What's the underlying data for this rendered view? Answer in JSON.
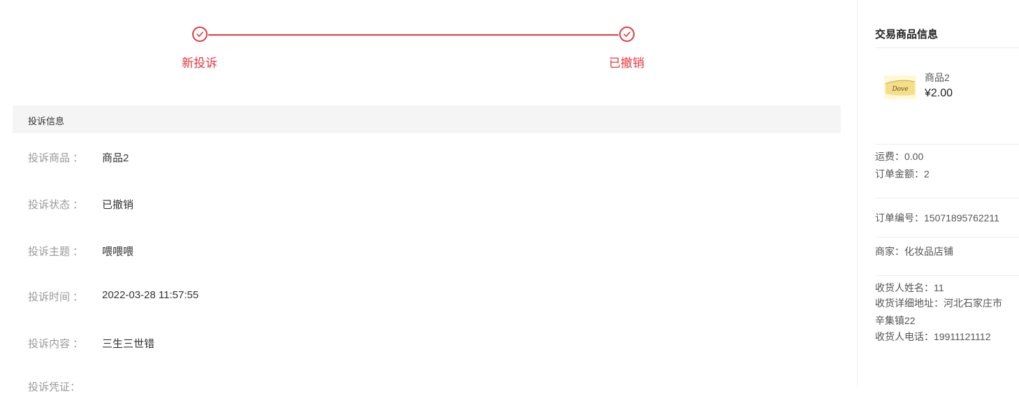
{
  "steps": [
    {
      "label": "新投诉",
      "state": "done"
    },
    {
      "label": "已撤销",
      "state": "done"
    }
  ],
  "accent_color": "#e4393c",
  "section": {
    "title": "投诉信息"
  },
  "info": {
    "colon": "：",
    "rows": [
      {
        "label": "投诉商品",
        "value": "商品2"
      },
      {
        "label": "投诉状态",
        "value": "已撤销"
      },
      {
        "label": "投诉主题",
        "value": "喂喂喂"
      },
      {
        "label": "投诉时间",
        "value": "2022-03-28 11:57:55"
      },
      {
        "label": "投诉内容",
        "value": "三生三世错"
      },
      {
        "label": "投诉凭证：",
        "value": ""
      }
    ]
  },
  "side": {
    "title": "交易商品信息",
    "product": {
      "name": "商品2",
      "price": "¥2.00",
      "image": "dove-chocolate-thumbnail"
    },
    "shipping_fee": "运费：0.00",
    "order_amount": "订单金额：2",
    "order_no": "订单编号：15071895762211",
    "merchant": "商家：化妆品店铺",
    "receiver_name": "收货人姓名：11",
    "receiver_address_1": "收货详细地址：河北石家庄市",
    "receiver_address_2": "辛集镇22",
    "receiver_phone": "收货人电话：19911121112"
  }
}
